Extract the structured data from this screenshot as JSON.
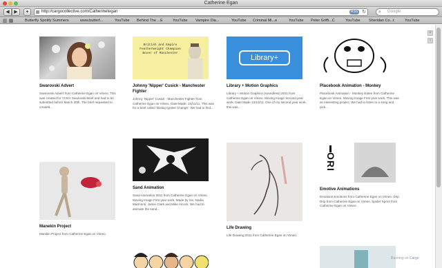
{
  "window": {
    "title": "Catherine Egan"
  },
  "toolbar": {
    "url": "http://cargocollective.com/Catherinetegan",
    "rss_label": "RSS",
    "search_placeholder": "Google"
  },
  "bookmarks": [
    "Butterfly Spotify Summers",
    "www.butterf...",
    "YouTube",
    "Behind The ...E",
    "YouTube",
    "Vampire Dia...",
    "YouTube",
    "Criminal Mi...e",
    "YouTube",
    "Peter Griffi...C",
    "YouTube",
    "Sheridan Co...t",
    "YouTube"
  ],
  "projects": [
    {
      "title": "Swarovski Advert",
      "desc": "Swarovski Advert from Catherine Egan on Vimeo. This was created for YCN's Swarovski Brief and had to be submitted before March 30th. The brief requested to created..."
    },
    {
      "title": "Johnny 'Nipper' Cusick - Manchester Fighter",
      "desc": "Johnny 'Nipper' Cusick - Manchester Fighter from Catherine Egan on Vimeo. Date Made: 24/11/11. This was for a brief called 'Dialog Ignites Change'. We had to find...",
      "thumb_text": "British and Empire\nFeatherweight Champion\nBoxer of Manchester"
    },
    {
      "title": "Library + Motion Graphics",
      "desc": "Library + Motion Graphics (soundless) 2011 from Catherine Egan on Vimeo. Moving Image Second year work. Date Made 13/10/11. One of my second year work, this was...",
      "thumb_text": "Library+"
    },
    {
      "title": "Placebook Animation - Monkey",
      "desc": "Placebook Animation - Monkey Eaten from Catherine Egan on Vimeo. Moving Image First year work. This was an interesting project. We had to listen to a song and pick..."
    },
    {
      "title": "Manekin Project",
      "desc": "Manikin Project from Catherine Egan on Vimeo."
    },
    {
      "title": "Sand Animation",
      "desc": "Sand Animation 2011 from Catherine Egan on Vimeo. Moving Image First year work. Made by me, Nadia Marmonti, Jamie Clark and Mike Alcock. We had to animate the sand..."
    },
    {
      "title": "Life Drawing",
      "desc": "Life Drawing 2011 from Catherine Egan on Vimeo."
    },
    {
      "title": "Emotive Animations",
      "desc": "Emotions Emotions from Catherine Egan on Vimeo. Drip Drip from Catherine Egan on Vimeo. Spider Sprint from Catherine Egan on Vimeo.",
      "thumb_text": "ORI"
    }
  ],
  "footer": {
    "powered_prefix": "Running on",
    "powered_link": "Cargo"
  },
  "colors": {
    "library_blue": "#3a8fdc",
    "nipper_yellow": "#f6efa0"
  }
}
